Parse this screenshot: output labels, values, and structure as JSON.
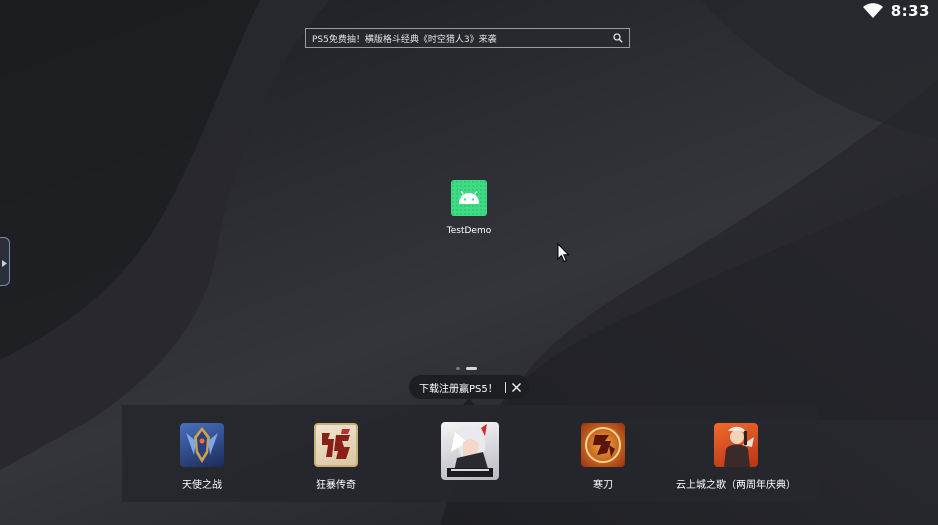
{
  "status": {
    "time": "8:33",
    "wifi_icon": "wifi-icon"
  },
  "search": {
    "text": "PS5免费抽！横版格斗经典《时空猎人3》来袭",
    "icon": "search-icon"
  },
  "desktop": {
    "app_label": "TestDemo",
    "app_icon": "android-icon"
  },
  "pager": {
    "pages": 2,
    "current": 2
  },
  "promo": {
    "text": "下载注册赢PS5！",
    "close_icon": "close-icon"
  },
  "dock": {
    "items": [
      {
        "label": "天使之战",
        "color": "#2d4a8a"
      },
      {
        "label": "狂暴传奇",
        "color": "#8a1f1a"
      },
      {
        "label": "",
        "color": "#d9d9dd"
      },
      {
        "label": "寒刀",
        "color": "#c2521a"
      },
      {
        "label": "云上城之歌（两周年庆典）",
        "color": "#d04a1e"
      }
    ]
  }
}
